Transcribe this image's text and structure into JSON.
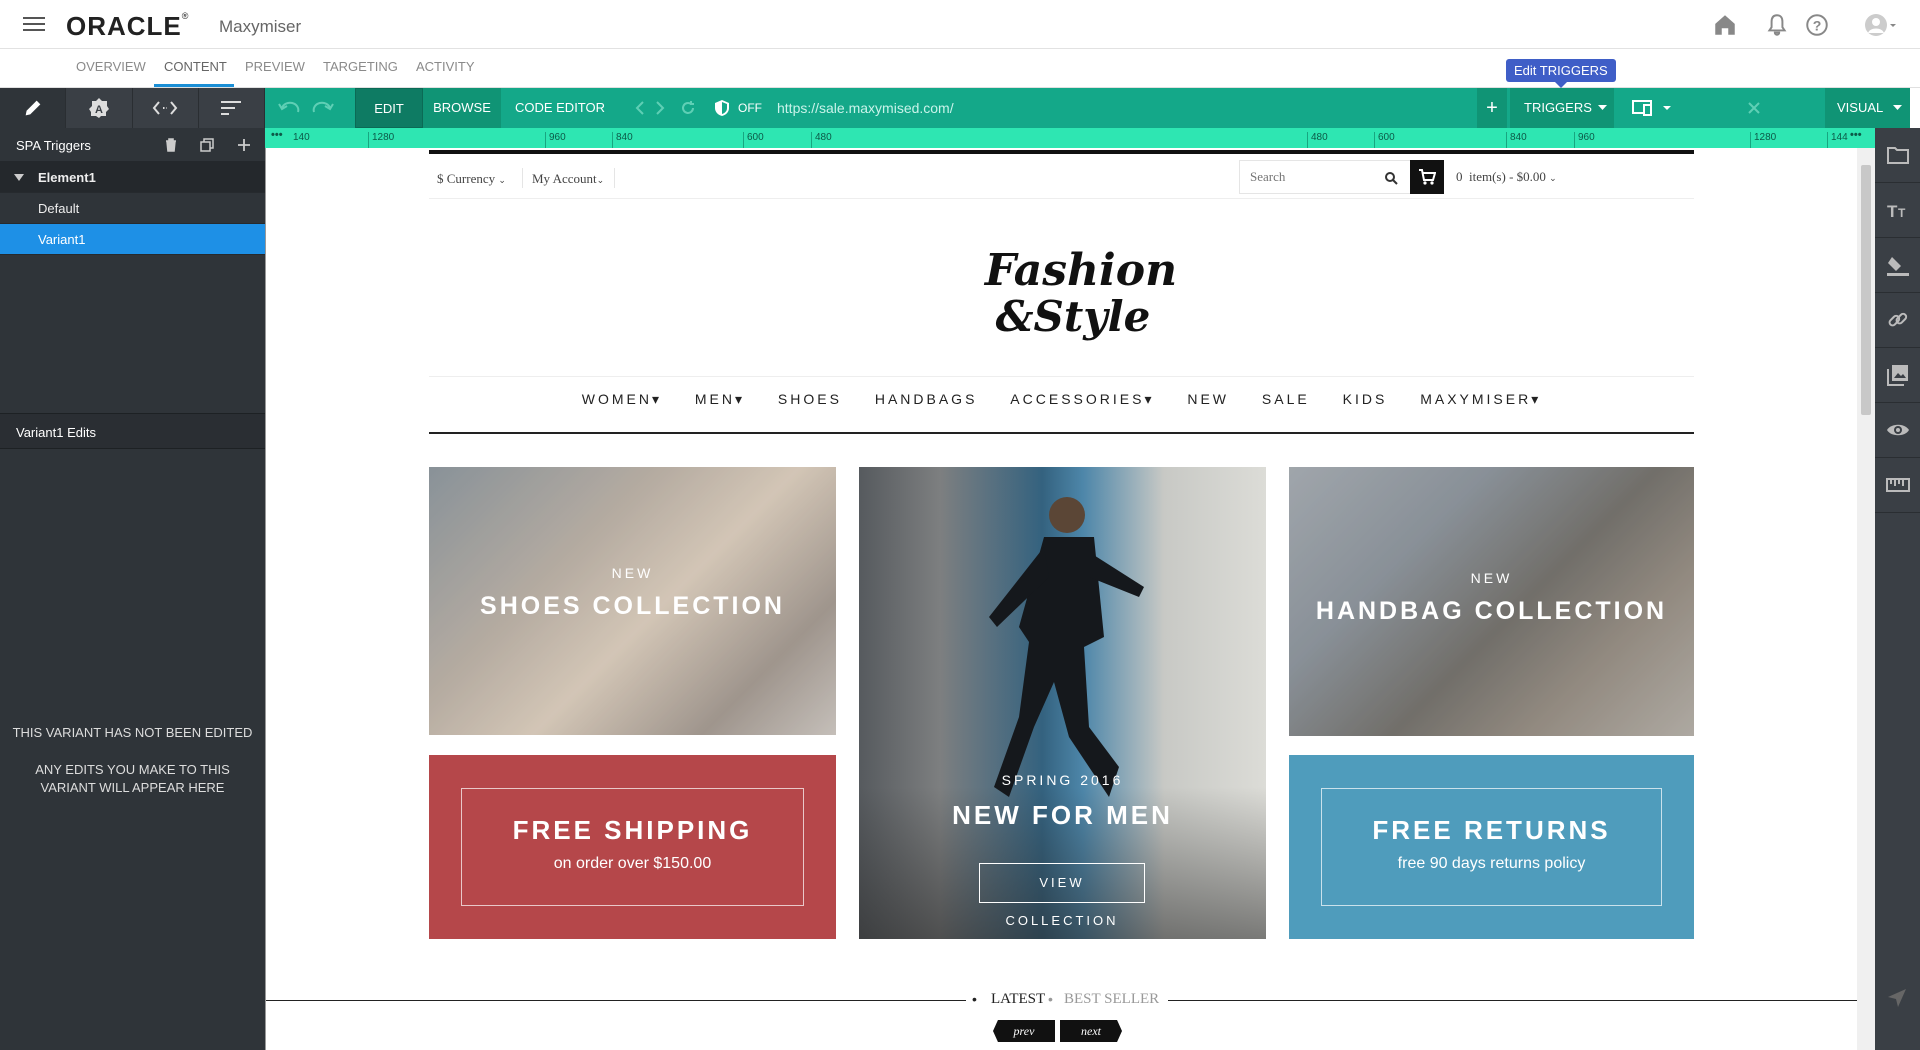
{
  "app": {
    "brand": "ORACLE",
    "product": "Maxymiser"
  },
  "tabs": [
    {
      "label": "OVERVIEW"
    },
    {
      "label": "CONTENT"
    },
    {
      "label": "PREVIEW"
    },
    {
      "label": "TARGETING"
    },
    {
      "label": "ACTIVITY"
    }
  ],
  "sidebar": {
    "spa_title": "SPA Triggers",
    "tree": {
      "element": "Element1",
      "default": "Default",
      "variant": "Variant1"
    },
    "edits_title": "Variant1 Edits",
    "empty_line1": "THIS VARIANT HAS NOT BEEN EDITED",
    "empty_line2": "ANY EDITS YOU MAKE TO THIS VARIANT WILL APPEAR HERE"
  },
  "editor": {
    "edit": "EDIT",
    "browse": "BROWSE",
    "code_editor": "CODE EDITOR",
    "safe_mode": "OFF",
    "url": "https://sale.maxymised.com/",
    "plus": "+",
    "triggers": "TRIGGERS",
    "visual": "VISUAL",
    "tooltip": "Edit TRIGGERS"
  },
  "ruler": {
    "labels": [
      "140",
      "1280",
      "960",
      "840",
      "600",
      "480",
      "480",
      "600",
      "840",
      "960",
      "1280",
      "144"
    ]
  },
  "site": {
    "currency": "$ Currency",
    "account": "My Account",
    "search_placeholder": "Search",
    "cart": "0  item(s) - $0.00",
    "nav": [
      "WOMEN",
      "MEN",
      "SHOES",
      "HANDBAGS",
      "ACCESSORIES",
      "NEW",
      "SALE",
      "KIDS",
      "MAXYMISER"
    ],
    "tiles": {
      "shoes": {
        "small": "NEW",
        "big": "SHOES COLLECTION"
      },
      "men": {
        "small": "SPRING 2016",
        "big": "NEW FOR MEN",
        "button": "VIEW COLLECTION"
      },
      "handbag": {
        "small": "NEW",
        "big": "HANDBAG COLLECTION"
      },
      "shipping": {
        "big": "FREE SHIPPING",
        "sub": "on order over $150.00"
      },
      "returns": {
        "big": "FREE RETURNS",
        "sub": "free 90 days returns policy"
      }
    },
    "product_tabs": {
      "latest": "LATEST",
      "best": "BEST SELLER"
    },
    "pager": {
      "prev": "prev",
      "next": "next"
    }
  },
  "colors": {
    "toolbar": "#14a889",
    "ruler": "#2ee6b2",
    "selected": "#1e90e6",
    "shipping": "#b5474a",
    "returns": "#4f9cbc"
  }
}
